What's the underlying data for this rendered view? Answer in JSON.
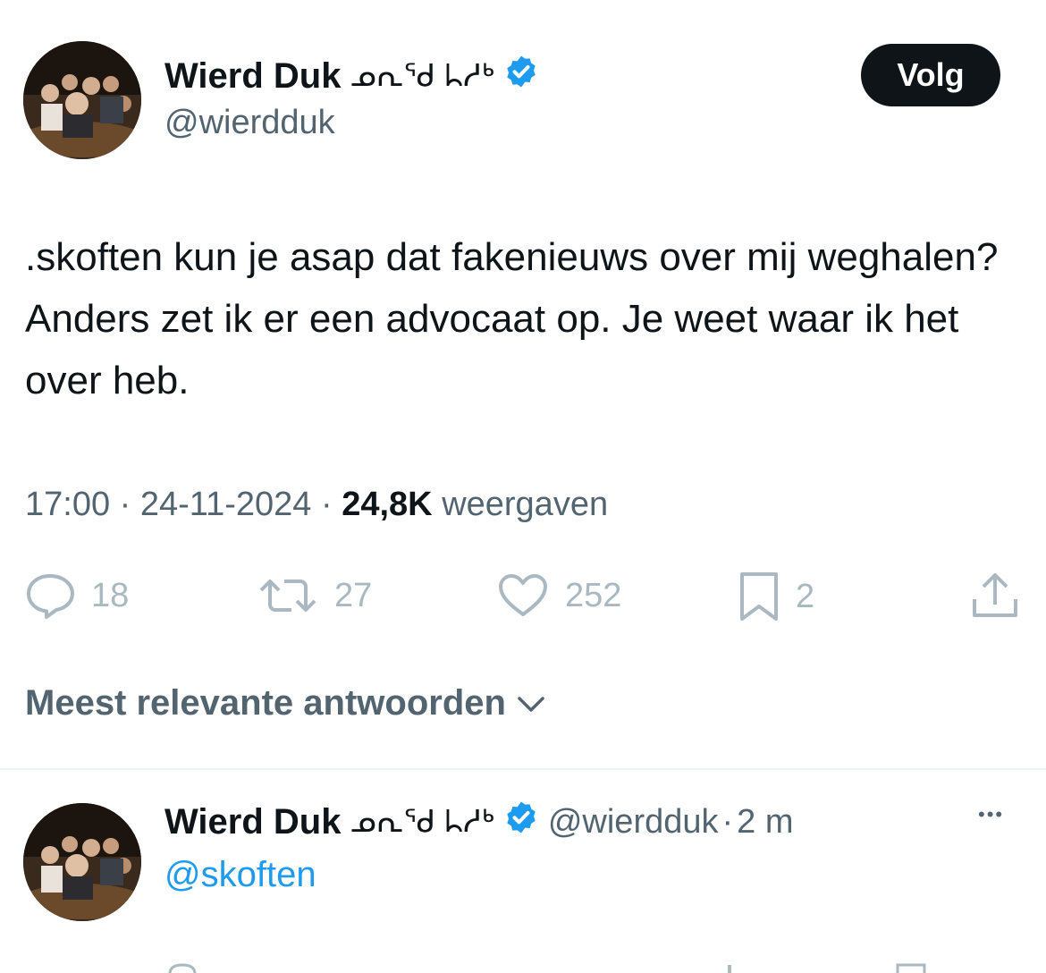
{
  "tweet": {
    "author_name": "Wierd Duk",
    "author_glyphs": "ᓄᕆᖁ ᖺᓱᒃ",
    "author_handle": "@wierdduk",
    "follow_label": "Volg",
    "text": ".skoften kun je asap dat fakenieuws over mij weghalen? Anders zet ik er een advocaat op. Je weet waar ik het over heb.",
    "time": "17:00",
    "date": "24-11-2024",
    "views_count": "24,8K",
    "views_label": "weergaven",
    "actions": {
      "replies": "18",
      "retweets": "27",
      "likes": "252",
      "bookmarks": "2"
    }
  },
  "replies_sort": {
    "label": "Meest relevante antwoorden"
  },
  "reply": {
    "author_name": "Wierd Duk",
    "author_glyphs": "ᓄᕆᖁ ᖺᓱᒃ",
    "author_handle": "@wierdduk",
    "separator": "·",
    "age": "2 m",
    "mention": "@skoften",
    "more_label": "•••"
  },
  "colors": {
    "verified": "#1d9bf0",
    "link": "#1d9bf0",
    "muted": "#536471",
    "action_icons": "#aab8c2"
  }
}
